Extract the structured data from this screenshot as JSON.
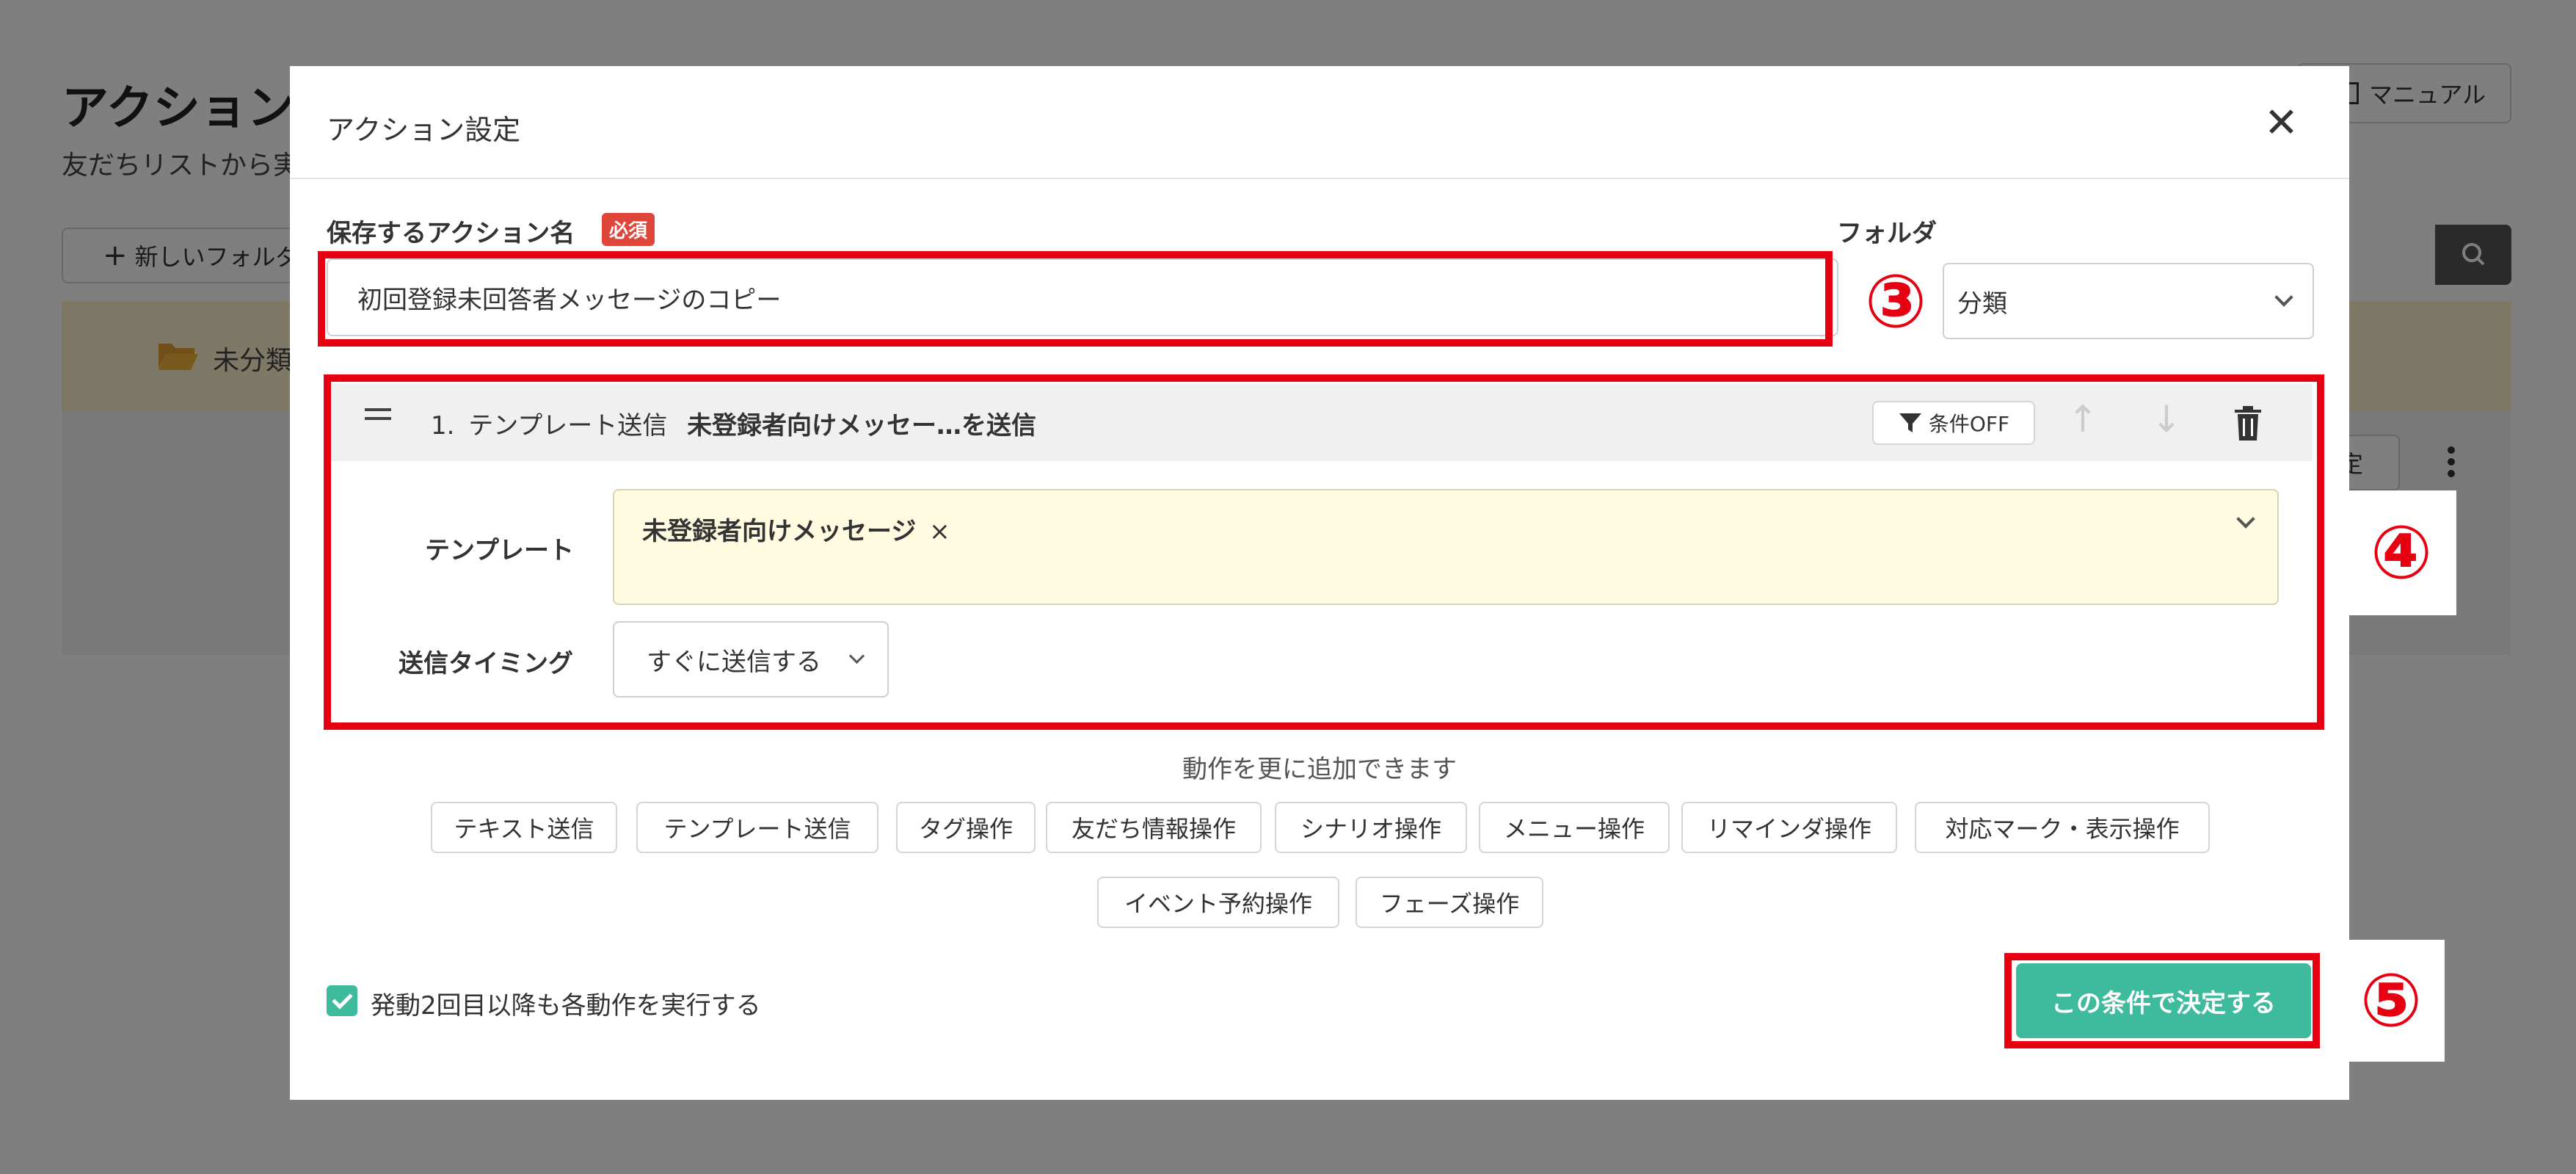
{
  "background": {
    "page_title": "アクション",
    "page_subtitle": "友だちリストから実",
    "new_folder_button": "新しいフォルダ",
    "manual_button": "マニュアル",
    "folder_name": "未分類",
    "row_button": "定"
  },
  "modal": {
    "title": "アクション設定",
    "name_label": "保存するアクション名",
    "required_badge": "必須",
    "name_value": "初回登録未回答者メッセージのコピー",
    "folder_label": "フォルダ",
    "folder_value": "分類",
    "action": {
      "number": "1.",
      "type": "テンプレート送信",
      "summary": "未登録者向けメッセー…を送信",
      "condition_button": "条件OFF",
      "template_label": "テンプレート",
      "template_value": "未登録者向けメッセージ",
      "template_remove": "×",
      "timing_label": "送信タイミング",
      "timing_value": "すぐに送信する"
    },
    "add_hint": "動作を更に追加できます",
    "add_buttons": [
      "テキスト送信",
      "テンプレート送信",
      "タグ操作",
      "友だち情報操作",
      "シナリオ操作",
      "メニュー操作",
      "リマインダ操作",
      "対応マーク・表示操作",
      "イベント予約操作",
      "フェーズ操作"
    ],
    "repeat_checkbox_label": "発動2回目以降も各動作を実行する",
    "repeat_checked": true,
    "submit_button": "この条件で決定する"
  },
  "annotations": [
    "③",
    "④",
    "⑤"
  ],
  "colors": {
    "accent_green": "#3dbb9c",
    "highlight_red": "#e60012",
    "required_red": "#e0453a",
    "template_bg": "#fffbe0"
  }
}
